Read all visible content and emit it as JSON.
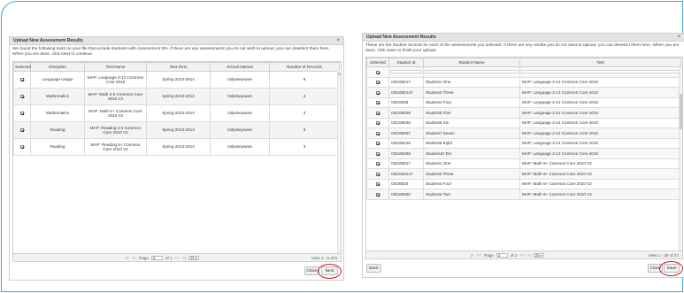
{
  "left_dialog": {
    "title": "Upload New Assessment Results",
    "close_glyph": "×",
    "description": "We found the following tests on your file that include students with Assessment IDs. If there are any assessments you do not wish to upload, you can deselect them here. When you are done, click Next to continue.",
    "columns": [
      "Selected",
      "Discipline",
      "Test Name",
      "Test Term",
      "School Names",
      "Number of Records"
    ],
    "rows": [
      {
        "discipline": "Language Usage",
        "test_name": "MAP: Language 2-12 Common Core 2010",
        "term": "Spring 2013-2014",
        "school": "Odysseyware",
        "records": "8"
      },
      {
        "discipline": "Mathematics",
        "test_name": "MAP: Math 2-5 Common Core 2010 V2",
        "term": "Spring 2013-2014",
        "school": "Odysseyware",
        "records": "4"
      },
      {
        "discipline": "Mathematics",
        "test_name": "MAP: Math 6+ Common Core 2010 V2",
        "term": "Spring 2013-2014",
        "school": "Odysseyware",
        "records": "3"
      },
      {
        "discipline": "Reading",
        "test_name": "MAP: Reading 2-5 Common Core 2010 V2",
        "term": "Spring 2013-2014",
        "school": "Odysseyware",
        "records": "3"
      },
      {
        "discipline": "Reading",
        "test_name": "MAP: Reading 6+ Common Core 2010 V2",
        "term": "Spring 2013-2014",
        "school": "Odysseyware",
        "records": "3"
      }
    ],
    "pager": {
      "first": "|<",
      "prev": "<<",
      "page_label": "Page",
      "page_value": "1",
      "of_label": "of 1",
      "next": ">>",
      "last": ">|",
      "page_size": "25 ▾",
      "view": "View 1 - 5 of 5"
    },
    "close_label": "Close",
    "next_label": "Next"
  },
  "right_dialog": {
    "title": "Upload New Assessment Results",
    "close_glyph": "×",
    "description": "These are the student records for each of the assessments you selected. If there are any results you do not want to upload, you can deselect them here. When you are done, click Save to finish your upload.",
    "columns": [
      "Selected",
      "Student Id",
      "Student Name",
      "Test"
    ],
    "rows": [
      {
        "id": "OE160017",
        "name": "Student1 One",
        "test": "MAP: Language 2-12 Common Core 2010"
      },
      {
        "id": "OE1600147",
        "name": "Student3 Three",
        "test": "MAP: Language 2-12 Common Core 2010"
      },
      {
        "id": "OE26028",
        "name": "Student4 Four",
        "test": "MAP: Language 2-12 Common Core 2010"
      },
      {
        "id": "OE160028",
        "name": "Student5 Five",
        "test": "MAP: Language 2-12 Common Core 2010"
      },
      {
        "id": "OE160045",
        "name": "Student6 Six",
        "test": "MAP: Language 2-12 Common Core 2010"
      },
      {
        "id": "OE160057",
        "name": "Student7 Seven",
        "test": "MAP: Language 2-12 Common Core 2010"
      },
      {
        "id": "OE160216",
        "name": "Student8 Eight",
        "test": "MAP: Language 2-12 Common Core 2010"
      },
      {
        "id": "OE160293",
        "name": "Student10 Ten",
        "test": "MAP: Language 2-12 Common Core 2010"
      },
      {
        "id": "OE160017",
        "name": "Student1 One",
        "test": "MAP: Math 6+ Common Core 2010 V2"
      },
      {
        "id": "OE1600147",
        "name": "Student3 Three",
        "test": "MAP: Math 6+ Common Core 2010 V2"
      },
      {
        "id": "OE26026",
        "name": "Student4 Four",
        "test": "MAP: Math 6+ Common Core 2010 V2"
      },
      {
        "id": "OE160050",
        "name": "Student2 Two",
        "test": "MAP: Math 6+ Common Core 2010 V2"
      }
    ],
    "pager": {
      "first": "|<",
      "prev": "<<",
      "page_label": "Page",
      "page_value": "1",
      "of_label": "of 2",
      "next": ">>",
      "last": ">|",
      "page_size": "25 ▾",
      "view": "View 1 - 25 of 27"
    },
    "back_label": "Back",
    "close_label": "Close",
    "save_label": "Save"
  },
  "colors": {
    "frame": "#3aa8de",
    "highlight_ring": "#c0242c"
  }
}
